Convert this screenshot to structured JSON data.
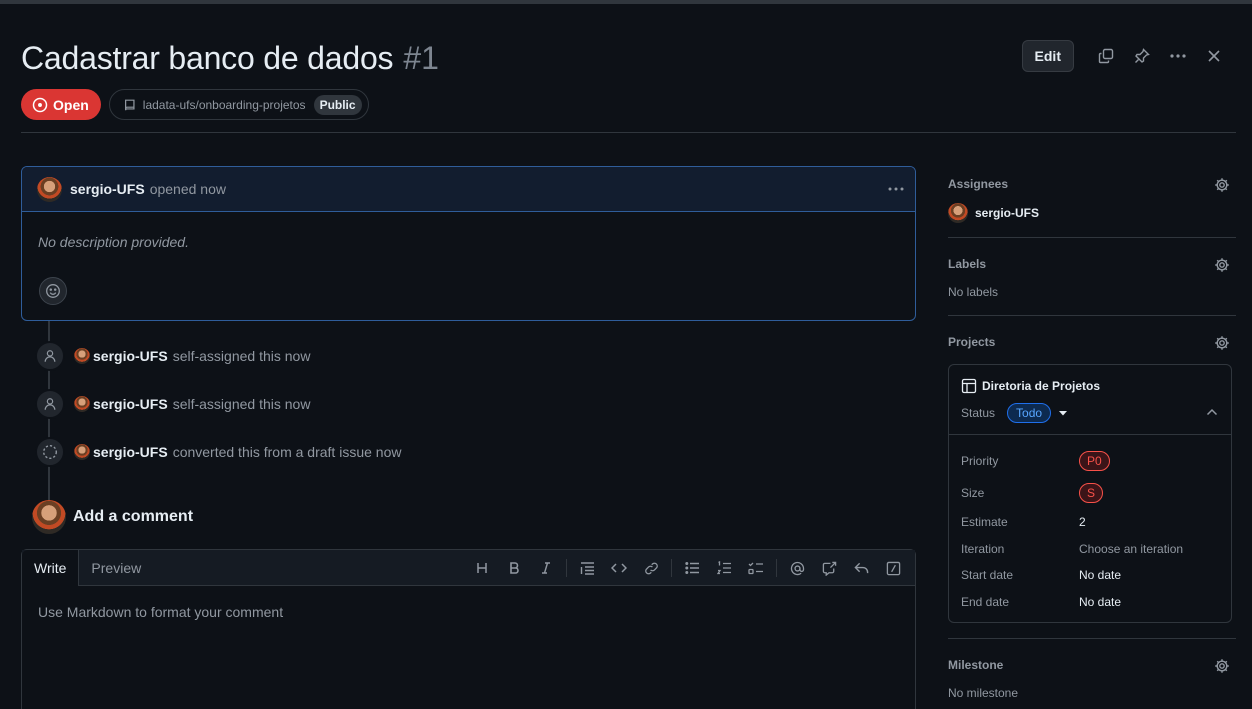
{
  "issue": {
    "title": "Cadastrar banco de dados",
    "number": "#1",
    "state": "Open",
    "repo": "ladata-ufs/onboarding-projetos",
    "visibility": "Public"
  },
  "header": {
    "edit_label": "Edit",
    "icons": [
      "copy-icon",
      "pin-icon",
      "kebab-horizontal-icon",
      "close-icon"
    ]
  },
  "comment": {
    "author": "sergio-UFS",
    "meta": "opened now",
    "body": "No description provided."
  },
  "timeline": [
    {
      "icon": "person-icon",
      "author": "sergio-UFS",
      "text": "self-assigned this now"
    },
    {
      "icon": "person-icon",
      "author": "sergio-UFS",
      "text": "self-assigned this now"
    },
    {
      "icon": "dashed-circle-icon",
      "author": "sergio-UFS",
      "text": "converted this from a draft issue now"
    }
  ],
  "composer": {
    "heading": "Add a comment",
    "tabs": [
      "Write",
      "Preview"
    ],
    "placeholder": "Use Markdown to format your comment",
    "toolbar": [
      "heading-icon",
      "bold-icon",
      "italic-icon",
      "quote-icon",
      "code-icon",
      "link-icon",
      "unordered-list-icon",
      "ordered-list-icon",
      "task-list-icon",
      "mention-icon",
      "cross-reference-icon",
      "reply-icon",
      "slash-command-icon"
    ]
  },
  "sidebar": {
    "assignees": {
      "title": "Assignees",
      "user": "sergio-UFS"
    },
    "labels": {
      "title": "Labels",
      "value": "No labels"
    },
    "projects": {
      "title": "Projects",
      "project_name": "Diretoria de Projetos",
      "status_label": "Status",
      "status_value": "Todo",
      "fields": [
        {
          "key": "Priority",
          "value": "P0"
        },
        {
          "key": "Size",
          "value": "S"
        },
        {
          "key": "Estimate",
          "value": "2"
        },
        {
          "key": "Iteration",
          "value": "Choose an iteration"
        },
        {
          "key": "Start date",
          "value": "No date"
        },
        {
          "key": "End date",
          "value": "No date"
        }
      ]
    },
    "milestone": {
      "title": "Milestone",
      "value": "No milestone"
    }
  },
  "colors": {
    "background": "#0d1117",
    "open_badge": "#da3633",
    "accent_blue": "#58a6ff",
    "danger_red": "#f85149"
  }
}
